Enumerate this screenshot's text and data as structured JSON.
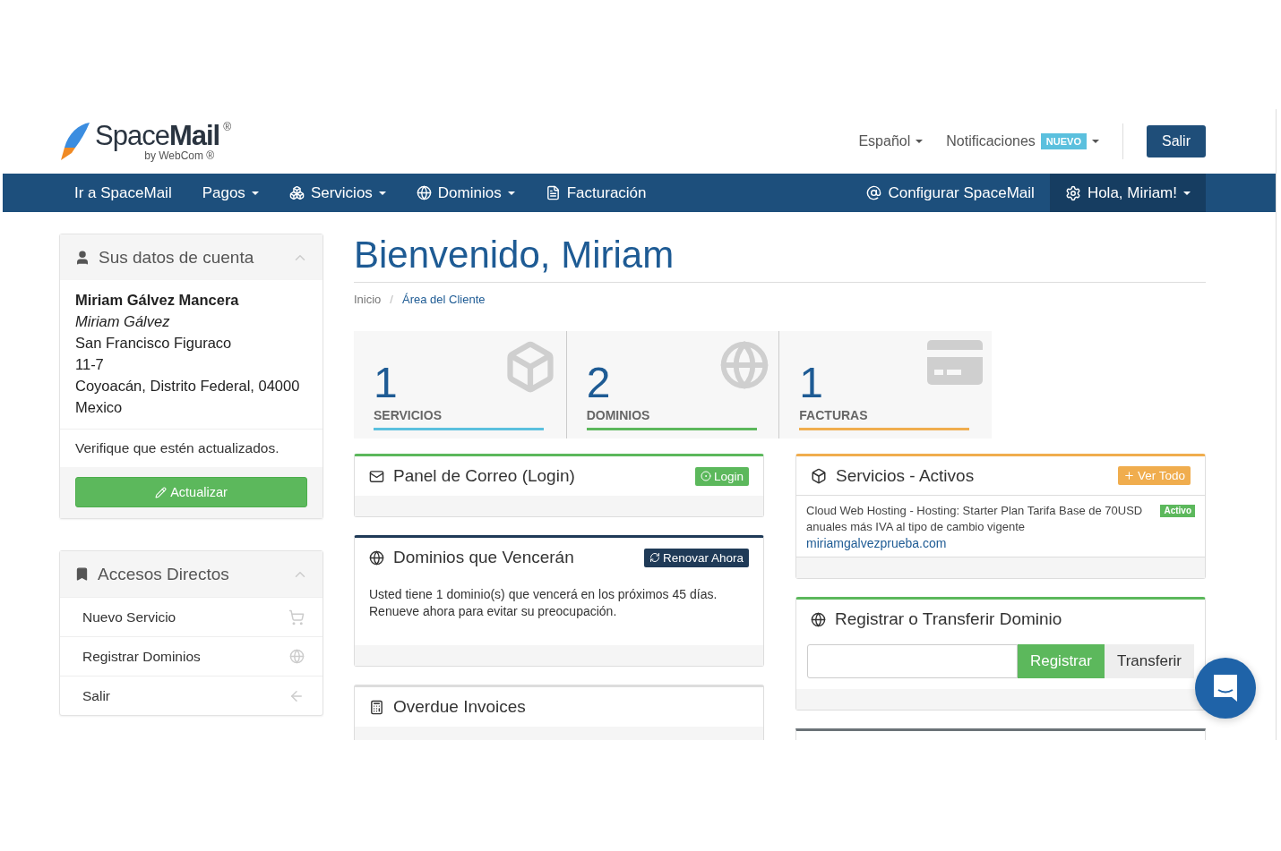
{
  "header": {
    "logo": {
      "name": "Space**Mail**",
      "mark": "®",
      "sub": "by WebCom",
      "sub_mark": "®"
    },
    "language": "Español",
    "notifications": {
      "label": "Notificaciones",
      "badge": "NUEVO"
    },
    "logout": "Salir"
  },
  "nav": {
    "left": [
      {
        "label": "Ir a SpaceMail",
        "dropdown": false
      },
      {
        "label": "Pagos",
        "dropdown": true
      },
      {
        "label": "Servicios",
        "dropdown": true
      },
      {
        "label": "Dominios",
        "dropdown": true
      },
      {
        "label": "Facturación",
        "dropdown": false
      }
    ],
    "right": [
      {
        "label": "Configurar SpaceMail",
        "dropdown": false,
        "selected": false
      },
      {
        "label": "Hola, Miriam!",
        "dropdown": true,
        "selected": true
      }
    ]
  },
  "account": {
    "title": "Sus datos de cuenta",
    "name": "Miriam Gálvez Mancera",
    "company": "Miriam Gálvez",
    "address": [
      "San Francisco Figuraco",
      "11-7",
      "Coyoacán, Distrito Federal, 04000",
      "Mexico"
    ],
    "note": "Verifique que estén actualizados.",
    "button": "Actualizar"
  },
  "shortcuts": {
    "title": "Accesos Directos",
    "items": [
      "Nuevo Servicio",
      "Registrar Dominios",
      "Salir"
    ]
  },
  "page": {
    "title": "Bienvenido, Miriam",
    "separator": "/",
    "breadcrumb": [
      {
        "label": "Inicio",
        "selected": false
      },
      {
        "label": "Área del Cliente",
        "selected": true
      }
    ]
  },
  "stats": [
    {
      "count": "1",
      "label": "SERVICIOS",
      "color": "#5bc0de"
    },
    {
      "count": "2",
      "label": "DOMINIOS",
      "color": "#5cb85c"
    },
    {
      "count": "1",
      "label": "FACTURAS",
      "color": "#f0ad4e"
    }
  ],
  "panels_left": [
    {
      "title": "Panel de Correo (Login)",
      "color": "#5cb85c",
      "button": "Login"
    },
    {
      "title": "Dominios que Vencerán",
      "color": "#1f3a57",
      "button": "Renovar Ahora",
      "body": "Usted tiene 1 dominio(s) que vencerá en los próximos 45 días. Renueve ahora para evitar su preocupación."
    },
    {
      "title": "Overdue Invoices",
      "color": "#dddddd"
    }
  ],
  "services": {
    "title": "Servicios - Activos",
    "color": "#f0ad4e",
    "button": "Ver Todo",
    "item": "Cloud Web Hosting - Hosting: Starter Plan Tarifa Base de 70USD anuales más IVA al tipo de cambio vigente",
    "status": "Activo",
    "domain": "miriamgalvezprueba.com"
  },
  "register": {
    "title": "Registrar o Transferir Dominio",
    "color": "#5cb85c",
    "buttons": [
      {
        "label": "Registrar",
        "selected": true
      },
      {
        "label": "Transferir",
        "selected": false
      }
    ]
  },
  "next_panel": {
    "color": "#6b7378"
  }
}
